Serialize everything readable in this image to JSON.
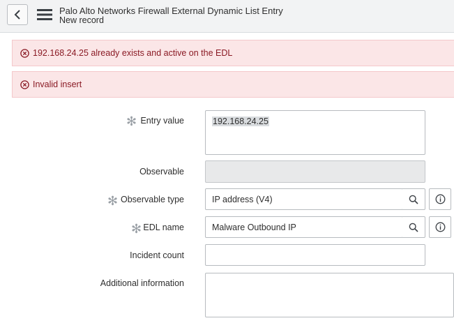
{
  "header": {
    "title": "Palo Alto Networks Firewall External Dynamic List Entry",
    "subtitle": "New record"
  },
  "alerts": [
    {
      "message": "192.168.24.25 already exists and active on the EDL"
    },
    {
      "message": "Invalid insert"
    }
  ],
  "form": {
    "entry_value": {
      "label": "Entry value",
      "value": "192.168.24.25",
      "mandatory": true
    },
    "observable": {
      "label": "Observable",
      "value": "",
      "mandatory": false
    },
    "observable_type": {
      "label": "Observable type",
      "value": "IP address (V4)",
      "mandatory": true
    },
    "edl_name": {
      "label": "EDL name",
      "value": "Malware Outbound IP",
      "mandatory": true
    },
    "incident_count": {
      "label": "Incident count",
      "value": "",
      "mandatory": false
    },
    "additional_information": {
      "label": "Additional information",
      "value": "",
      "mandatory": false
    }
  },
  "colors": {
    "alert_bg": "#fbe6e7",
    "alert_text": "#8a1a24",
    "header_bg": "#f2f3f4"
  }
}
